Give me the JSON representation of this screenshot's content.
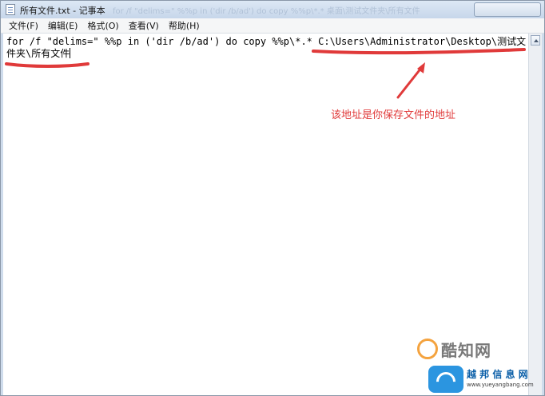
{
  "window": {
    "title": "所有文件.txt - 记事本",
    "title_ghost": "for /f \"delims=\" %%p in ('dir /b/ad') do copy %%p\\*.* 桌面\\测试文件夹\\所有文件"
  },
  "menu": [
    {
      "label": "文件(F)"
    },
    {
      "label": "编辑(E)"
    },
    {
      "label": "格式(O)"
    },
    {
      "label": "查看(V)"
    },
    {
      "label": "帮助(H)"
    }
  ],
  "editor": {
    "text": "for /f \"delims=\" %%p in ('dir /b/ad') do copy %%p\\*.* C:\\Users\\Administrator\\Desktop\\测试文件夹\\所有文件"
  },
  "annotation": {
    "note": "该地址是你保存文件的地址",
    "color": "#e03a3a"
  },
  "watermarks": {
    "wm1": "酷知网",
    "wm2_title": "越 邦 信 息 网",
    "wm2_url": "www.yueyangbang.com"
  }
}
